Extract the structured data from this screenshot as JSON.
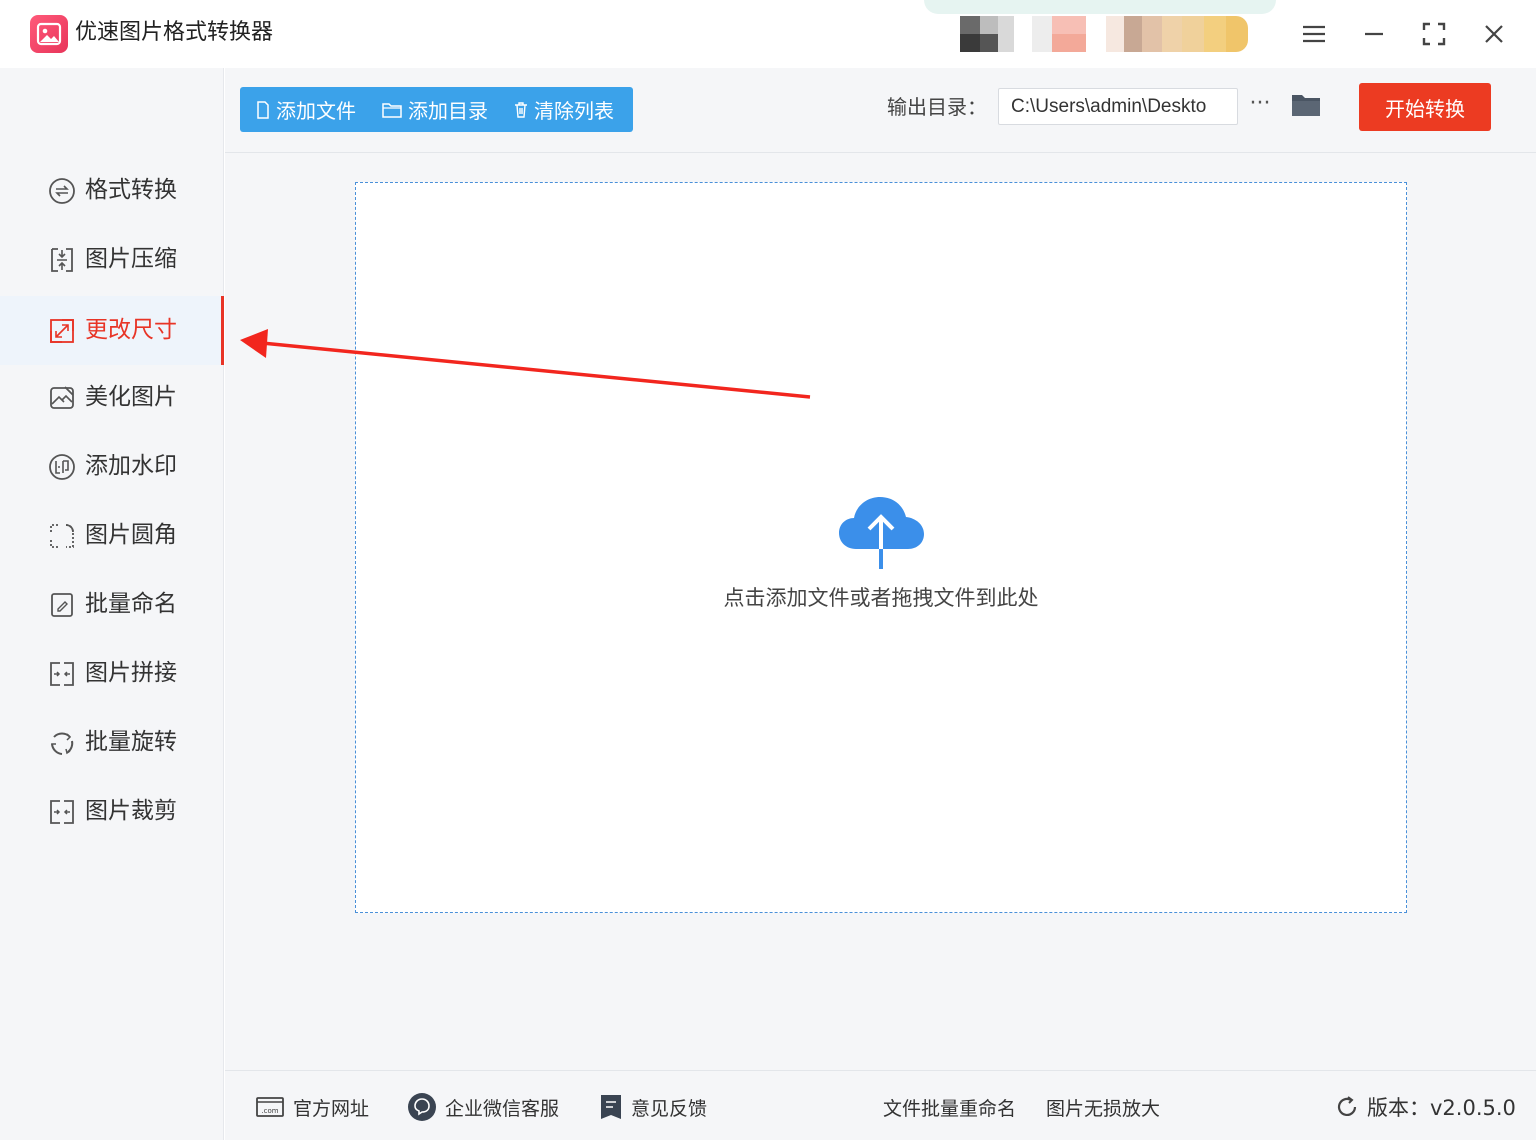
{
  "app": {
    "title": "优速图片格式转换器",
    "accent_color": "#3ba2ea",
    "active_color": "#e83426",
    "start_color": "#ec3b22"
  },
  "window_controls": [
    {
      "name": "menu-icon"
    },
    {
      "name": "minimize-icon"
    },
    {
      "name": "maximize-icon"
    },
    {
      "name": "close-icon"
    }
  ],
  "sidebar": {
    "items": [
      {
        "label": "格式转换",
        "icon": "format-convert-icon",
        "active": false
      },
      {
        "label": "图片压缩",
        "icon": "compress-icon",
        "active": false
      },
      {
        "label": "更改尺寸",
        "icon": "resize-icon",
        "active": true
      },
      {
        "label": "美化图片",
        "icon": "beautify-icon",
        "active": false
      },
      {
        "label": "添加水印",
        "icon": "watermark-icon",
        "active": false
      },
      {
        "label": "图片圆角",
        "icon": "rounded-corner-icon",
        "active": false
      },
      {
        "label": "批量命名",
        "icon": "rename-icon",
        "active": false
      },
      {
        "label": "图片拼接",
        "icon": "stitch-icon",
        "active": false
      },
      {
        "label": "批量旋转",
        "icon": "rotate-icon",
        "active": false
      },
      {
        "label": "图片裁剪",
        "icon": "crop-icon",
        "active": false
      }
    ]
  },
  "toolbar": {
    "add_file": "添加文件",
    "add_folder": "添加目录",
    "clear_list": "清除列表",
    "output_label": "输出目录：",
    "output_path": "C:\\Users\\admin\\Deskto",
    "more": "···",
    "start": "开始转换"
  },
  "dropzone": {
    "hint": "点击添加文件或者拖拽文件到此处"
  },
  "footer": {
    "website": "官方网址",
    "wechat_support": "企业微信客服",
    "feedback": "意见反馈",
    "batch_rename": "文件批量重命名",
    "lossless_enlarge": "图片无损放大",
    "version": "版本：v2.0.5.0"
  }
}
